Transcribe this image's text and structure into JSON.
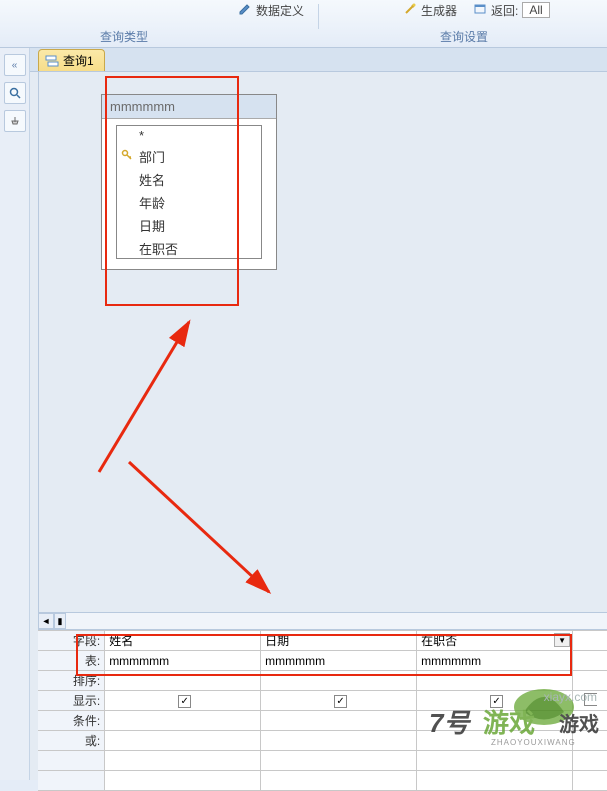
{
  "ribbon": {
    "data_def": "数据定义",
    "builder": "生成器",
    "return": "返回:",
    "return_value": "All",
    "group_query_type": "查询类型",
    "group_query_settings": "查询设置"
  },
  "sidebar": {
    "collapse": "«"
  },
  "tab": {
    "label": "查询1"
  },
  "table_box": {
    "title": "mmmmmm",
    "fields": {
      "star": "*",
      "dept": "部门",
      "name": "姓名",
      "age": "年龄",
      "date": "日期",
      "active": "在职否"
    }
  },
  "grid": {
    "labels": {
      "field": "字段:",
      "table": "表:",
      "sort": "排序:",
      "show": "显示:",
      "criteria": "条件:",
      "or": "或:"
    },
    "columns": [
      {
        "field": "姓名",
        "table": "mmmmmm",
        "show": true
      },
      {
        "field": "日期",
        "table": "mmmmmm",
        "show": true
      },
      {
        "field": "在职否",
        "table": "mmmmmm",
        "show": true
      }
    ]
  },
  "watermark": {
    "line1": "xiayx.com",
    "line2": "7号游戏网",
    "line3": "游戏",
    "line4": "ZHAOYOUXIWANG"
  }
}
